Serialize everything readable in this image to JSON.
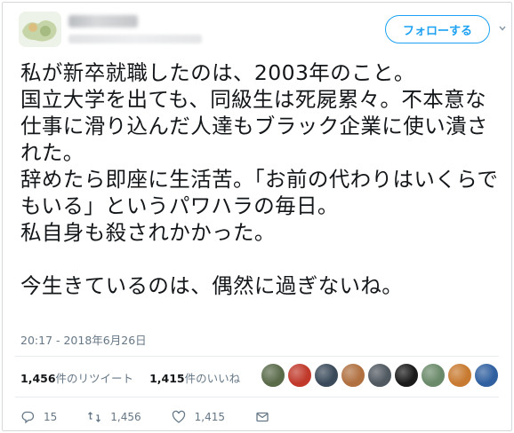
{
  "header": {
    "follow_label": "フォローする"
  },
  "tweet": {
    "text": "私が新卒就職したのは、2003年のこと。\n国立大学を出ても、同級生は死屍累々。不本意な仕事に滑り込んだ人達もブラック企業に使い潰された。\n辞めたら即座に生活苦。「お前の代わりはいくらでもいる」というパワハラの毎日。\n私自身も殺されかかった。\n\n今生きているのは、偶然に過ぎないね。",
    "timestamp": "20:17 - 2018年6月26日"
  },
  "stats": {
    "retweets_count": "1,456",
    "retweets_label": "件のリツイート",
    "likes_count": "1,415",
    "likes_label": "件のいいね"
  },
  "likers": {
    "avatar_colors": [
      "#5a6b4a",
      "#c0392b",
      "#3a4a5a",
      "#b07040",
      "#505860",
      "#1a1a1a",
      "#6a8a6a",
      "#c87a30",
      "#3060a0"
    ]
  },
  "actions": {
    "reply_count": "15",
    "retweet_count": "1,456",
    "like_count": "1,415"
  },
  "colors": {
    "accent": "#1da1f2",
    "muted": "#657786",
    "text": "#14171a"
  }
}
